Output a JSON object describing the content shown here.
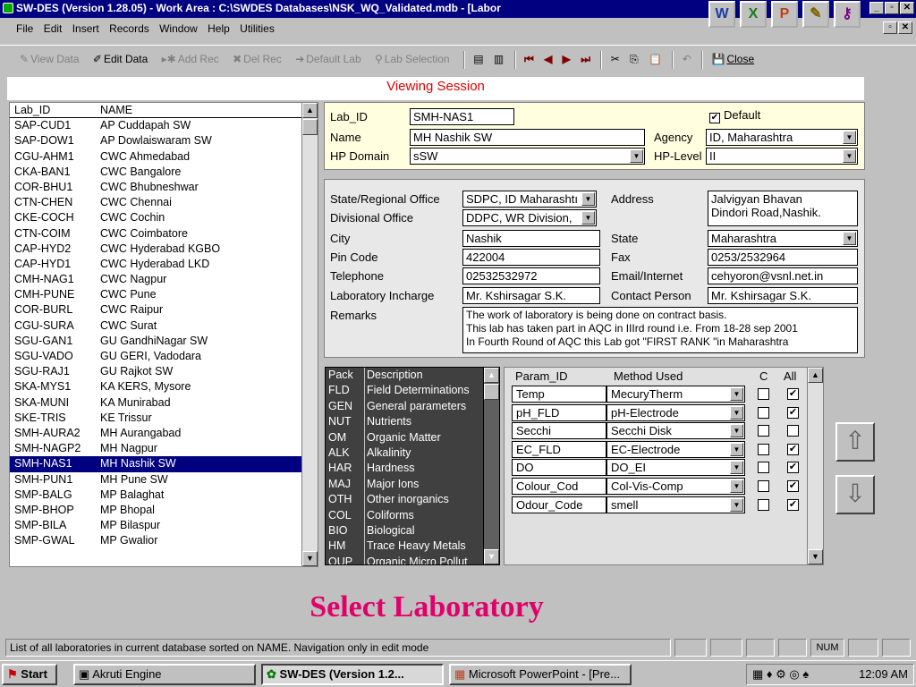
{
  "window": {
    "title": "SW-DES (Version 1.28.05) - Work Area : C:\\SWDES Databases\\NSK_WQ_Validated.mdb - [Labor"
  },
  "menu": [
    "File",
    "Edit",
    "Insert",
    "Records",
    "Window",
    "Help",
    "Utilities"
  ],
  "toolbar": {
    "view_data": "View Data",
    "edit_data": "Edit Data",
    "add_rec": "Add Rec",
    "del_rec": "Del Rec",
    "default_lab": "Default Lab",
    "lab_selection": "Lab Selection",
    "close": "Close"
  },
  "session_title": "Viewing Session",
  "lab_list": {
    "headers": [
      "Lab_ID",
      "NAME"
    ],
    "rows": [
      [
        "SAP-CUD1",
        "AP Cuddapah SW"
      ],
      [
        "SAP-DOW1",
        "AP Dowlaiswaram SW"
      ],
      [
        "CGU-AHM1",
        "CWC Ahmedabad"
      ],
      [
        "CKA-BAN1",
        "CWC Bangalore"
      ],
      [
        "COR-BHU1",
        "CWC Bhubneshwar"
      ],
      [
        "CTN-CHEN",
        "CWC Chennai"
      ],
      [
        "CKE-COCH",
        "CWC Cochin"
      ],
      [
        "CTN-COIM",
        "CWC Coimbatore"
      ],
      [
        "CAP-HYD2",
        "CWC Hyderabad KGBO"
      ],
      [
        "CAP-HYD1",
        "CWC Hyderabad LKD"
      ],
      [
        "CMH-NAG1",
        "CWC Nagpur"
      ],
      [
        "CMH-PUNE",
        "CWC Pune"
      ],
      [
        "COR-BURL",
        "CWC Raipur"
      ],
      [
        "CGU-SURA",
        "CWC Surat"
      ],
      [
        "SGU-GAN1",
        "GU GandhiNagar SW"
      ],
      [
        "SGU-VADO",
        "GU GERI, Vadodara"
      ],
      [
        "SGU-RAJ1",
        "GU Rajkot SW"
      ],
      [
        "SKA-MYS1",
        "KA KERS, Mysore"
      ],
      [
        "SKA-MUNI",
        "KA Munirabad"
      ],
      [
        "SKE-TRIS",
        "KE Trissur"
      ],
      [
        "SMH-AURA2",
        "MH Aurangabad"
      ],
      [
        "SMH-NAGP2",
        "MH Nagpur"
      ],
      [
        "SMH-NAS1",
        "MH Nashik SW"
      ],
      [
        "SMH-PUN1",
        "MH Pune SW"
      ],
      [
        "SMP-BALG",
        "MP Balaghat"
      ],
      [
        "SMP-BHOP",
        "MP Bhopal"
      ],
      [
        "SMP-BILA",
        "MP Bilaspur"
      ],
      [
        "SMP-GWAL",
        "MP Gwalior"
      ]
    ],
    "selected_index": 22
  },
  "lab": {
    "lab_id_label": "Lab_ID",
    "lab_id": "SMH-NAS1",
    "default_label": "Default",
    "default_checked": "✔",
    "name_label": "Name",
    "name": "MH Nashik SW",
    "agency_label": "Agency",
    "agency": "ID, Maharashtra",
    "hp_domain_label": "HP Domain",
    "hp_domain": "sSW",
    "hp_level_label": "HP-Level",
    "hp_level": "II"
  },
  "address": {
    "state_office_label": "State/Regional Office",
    "state_office": "SDPC, ID Maharashtı",
    "divisional_office_label": "Divisional Office",
    "divisional_office": "DDPC, WR Division,",
    "city_label": "City",
    "city": "Nashik",
    "pin_label": "Pin Code",
    "pin": "422004",
    "telephone_label": "Telephone",
    "telephone": "02532532972",
    "incharge_label": "Laboratory Incharge",
    "incharge": "Mr. Kshirsagar S.K.",
    "remarks_label": "Remarks",
    "remarks_1": "The work of laboratory is being done on contract basis.",
    "remarks_2": "This lab has taken part in AQC in IIIrd round i.e. From 18-28 sep 2001",
    "remarks_3": "In Fourth Round of AQC this Lab got \"FIRST RANK \"in Maharashtra",
    "address_label": "Address",
    "address_1": "Jalvigyan Bhavan",
    "address_2": "Dindori Road,Nashik.",
    "state_label": "State",
    "state": "Maharashtra",
    "fax_label": "Fax",
    "fax": "0253/2532964",
    "email_label": "Email/Internet",
    "email": "cehyoron@vsnl.net.in",
    "contact_label": "Contact Person",
    "contact": "Mr. Kshirsagar S.K."
  },
  "packs": {
    "headers": [
      "Pack",
      "Description"
    ],
    "rows": [
      [
        "FLD",
        "Field Determinations"
      ],
      [
        "GEN",
        "General parameters"
      ],
      [
        "NUT",
        "Nutrients"
      ],
      [
        "OM",
        "Organic Matter"
      ],
      [
        "ALK",
        "Alkalinity"
      ],
      [
        "HAR",
        "Hardness"
      ],
      [
        "MAJ",
        "Major Ions"
      ],
      [
        "OTH",
        "Other inorganics"
      ],
      [
        "COL",
        "Coliforms"
      ],
      [
        "BIO",
        "Biological"
      ],
      [
        "HM",
        "Trace Heavy Metals"
      ],
      [
        "OUP",
        "Organic Micro Pollut"
      ]
    ]
  },
  "params": {
    "headers": [
      "Param_ID",
      "Method Used",
      "C",
      "All"
    ],
    "rows": [
      {
        "id": "Temp",
        "method": "MecuryTherm",
        "c": "",
        "all": "✔"
      },
      {
        "id": "pH_FLD",
        "method": "pH-Electrode",
        "c": "",
        "all": "✔"
      },
      {
        "id": "Secchi",
        "method": "Secchi Disk",
        "c": "",
        "all": ""
      },
      {
        "id": "EC_FLD",
        "method": "EC-Electrode",
        "c": "",
        "all": "✔"
      },
      {
        "id": "DO",
        "method": "DO_EI",
        "c": "",
        "all": "✔"
      },
      {
        "id": "Colour_Cod",
        "method": "Col-Vis-Comp",
        "c": "",
        "all": "✔"
      },
      {
        "id": "Odour_Code",
        "method": "smell",
        "c": "",
        "all": "✔"
      }
    ]
  },
  "caption": "Select Laboratory",
  "status": {
    "text": "List of all laboratories in current database sorted on NAME. Navigation only in edit mode",
    "num": "NUM"
  },
  "taskbar": {
    "start": "Start",
    "akruti": "Akruti Engine",
    "swdes": "SW-DES (Version 1.2...",
    "ppt": "Microsoft PowerPoint - [Pre...",
    "time": "12:09 AM"
  },
  "icons": [
    "app-icon",
    "word-icon",
    "excel-icon",
    "powerpoint-icon",
    "paint-icon",
    "access-icon",
    "up-arrow-icon",
    "down-arrow-icon",
    "windows-flag-icon"
  ]
}
